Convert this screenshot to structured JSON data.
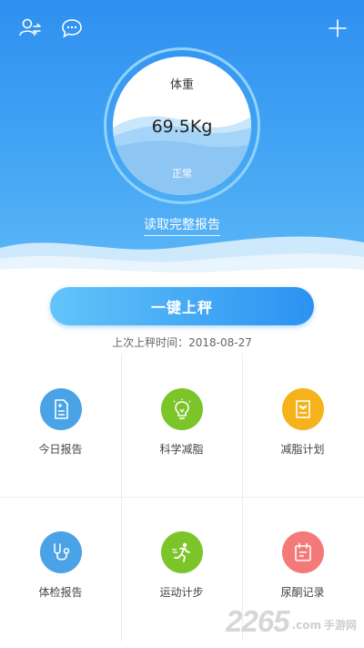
{
  "header": {
    "icons": [
      "user-switch-icon",
      "message-icon",
      "add-icon"
    ],
    "colors": {
      "top": "#2f8ff0",
      "bottom": "#5fb9f6"
    }
  },
  "gauge": {
    "title": "体重",
    "value": "69.5Kg",
    "status": "正常",
    "fill_level": 0.55
  },
  "report_link": "读取完整报告",
  "weigh_button": "一键上秤",
  "last_weigh": "上次上秤时间：2018-08-27",
  "grid": [
    {
      "label": "今日报告",
      "icon": "report-icon",
      "color": "#4aa3e6"
    },
    {
      "label": "科学减脂",
      "icon": "lightbulb-icon",
      "color": "#7cc529"
    },
    {
      "label": "减脂计划",
      "icon": "plan-icon",
      "color": "#f6b21b"
    },
    {
      "label": "体检报告",
      "icon": "stethoscope-icon",
      "color": "#4aa3e6"
    },
    {
      "label": "运动计步",
      "icon": "running-icon",
      "color": "#7cc529"
    },
    {
      "label": "尿酮记录",
      "icon": "calendar-icon",
      "color": "#f47a79"
    }
  ],
  "watermark": {
    "number": "2265",
    "suffix": ".com",
    "text": "手游网"
  }
}
